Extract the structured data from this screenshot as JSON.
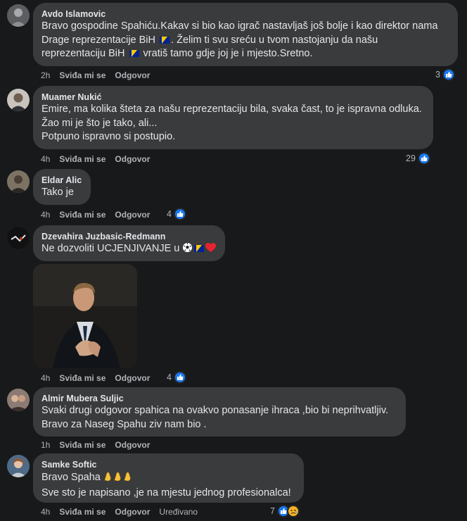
{
  "comments": [
    {
      "author": "Avdo Islamovic",
      "lines": [
        "Bravo gospodine Spahiću.Kakav si bio kao igrač nastavljaš još bolje i kao direktor nama",
        "Drage reprezentacije BiH",
        ". Želim ti svu sreću u tvom nastojanju da našu",
        "reprezentaciju BiH",
        "vratiš tamo gdje joj je i mjesto.Sretno."
      ],
      "time": "2h",
      "like_label": "Sviđa mi se",
      "reply_label": "Odgovor",
      "reactions": "3"
    },
    {
      "author": "Muamer Nukić",
      "lines": [
        "Emire, ma kolika šteta za našu reprezentaciju bila, svaka čast, to je ispravna odluka.",
        "Žao mi je što je tako, ali...",
        "Potpuno ispravno si postupio."
      ],
      "time": "4h",
      "like_label": "Sviđa mi se",
      "reply_label": "Odgovor",
      "reactions": "29"
    },
    {
      "author": "Eldar Alic",
      "lines": [
        "Tako je"
      ],
      "time": "4h",
      "like_label": "Sviđa mi se",
      "reply_label": "Odgovor",
      "reactions": "4"
    },
    {
      "author": "Dzevahira Juzbasic-Redmann",
      "lines": [
        "Ne dozvoliti UCJENJIVANJE u"
      ],
      "time": "4h",
      "like_label": "Sviđa mi se",
      "reply_label": "Odgovor",
      "reactions": "4"
    },
    {
      "author": "Almir Mubera Suljic",
      "lines": [
        "Svaki drugi odgovor spahica na ovakvo ponasanje ihraca ,bio bi neprihvatljiv.",
        "Bravo za Naseg Spahu ziv nam bio ."
      ],
      "time": "1h",
      "like_label": "Sviđa mi se",
      "reply_label": "Odgovor"
    },
    {
      "author": "Samke Softic",
      "lines": [
        "Bravo Spaha",
        "Sve sto je napisano ,je na mjestu jednog profesionalca!"
      ],
      "time": "4h",
      "like_label": "Sviđa mi se",
      "reply_label": "Odgovor",
      "edited": "Uređivano",
      "reactions": "7"
    }
  ],
  "icons": {
    "like_reaction": "like-icon",
    "sad_reaction": "sad-face-icon",
    "flag": "bosnia-flag-icon",
    "ball": "soccer-ball-icon",
    "heart": "heart-icon",
    "clap": "clapping-hands-icon"
  },
  "colors": {
    "background": "#18191a",
    "bubble": "#3a3b3c",
    "text": "#e4e6eb",
    "secondary": "#b0b3b8",
    "like_blue": "#1877f2"
  }
}
